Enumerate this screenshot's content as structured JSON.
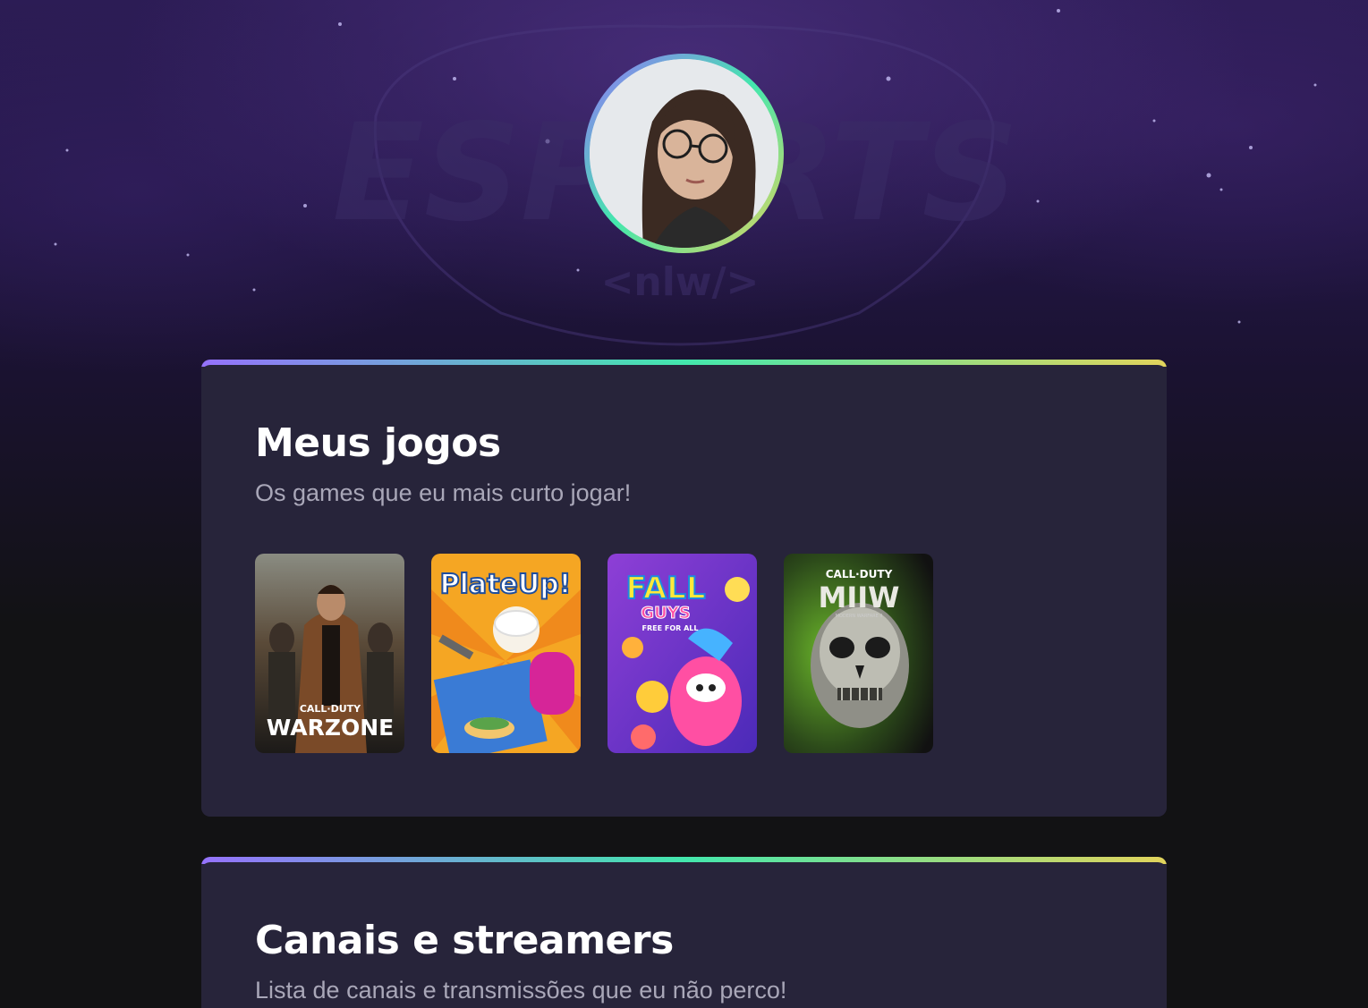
{
  "profile": {
    "avatar_icon": "profile-photo",
    "ring_colors": [
      "#9572fc",
      "#43e7ad",
      "#e2d45c"
    ]
  },
  "background": {
    "logo_watermark": "ESPORTS",
    "logo_sub": "<nlw/>"
  },
  "games_section": {
    "title": "Meus jogos",
    "subtitle": "Os games que eu mais curto jogar!",
    "games": [
      {
        "name": "Call of Duty Warzone",
        "logo_top": "CALL·DUTY",
        "logo_main": "WARZONE"
      },
      {
        "name": "PlateUp!",
        "logo_main": "PlateUp!"
      },
      {
        "name": "Fall Guys",
        "logo_main": "FALL",
        "logo_sub": "GUYS",
        "logo_tag": "FREE FOR ALL"
      },
      {
        "name": "Call of Duty Modern Warfare II",
        "logo_top": "CALL·DUTY",
        "logo_main": "MIIW",
        "logo_sub": "MODERN WARFARE II"
      }
    ]
  },
  "streamers_section": {
    "title": "Canais e streamers",
    "subtitle": "Lista de canais e transmissões que eu não perco!"
  }
}
